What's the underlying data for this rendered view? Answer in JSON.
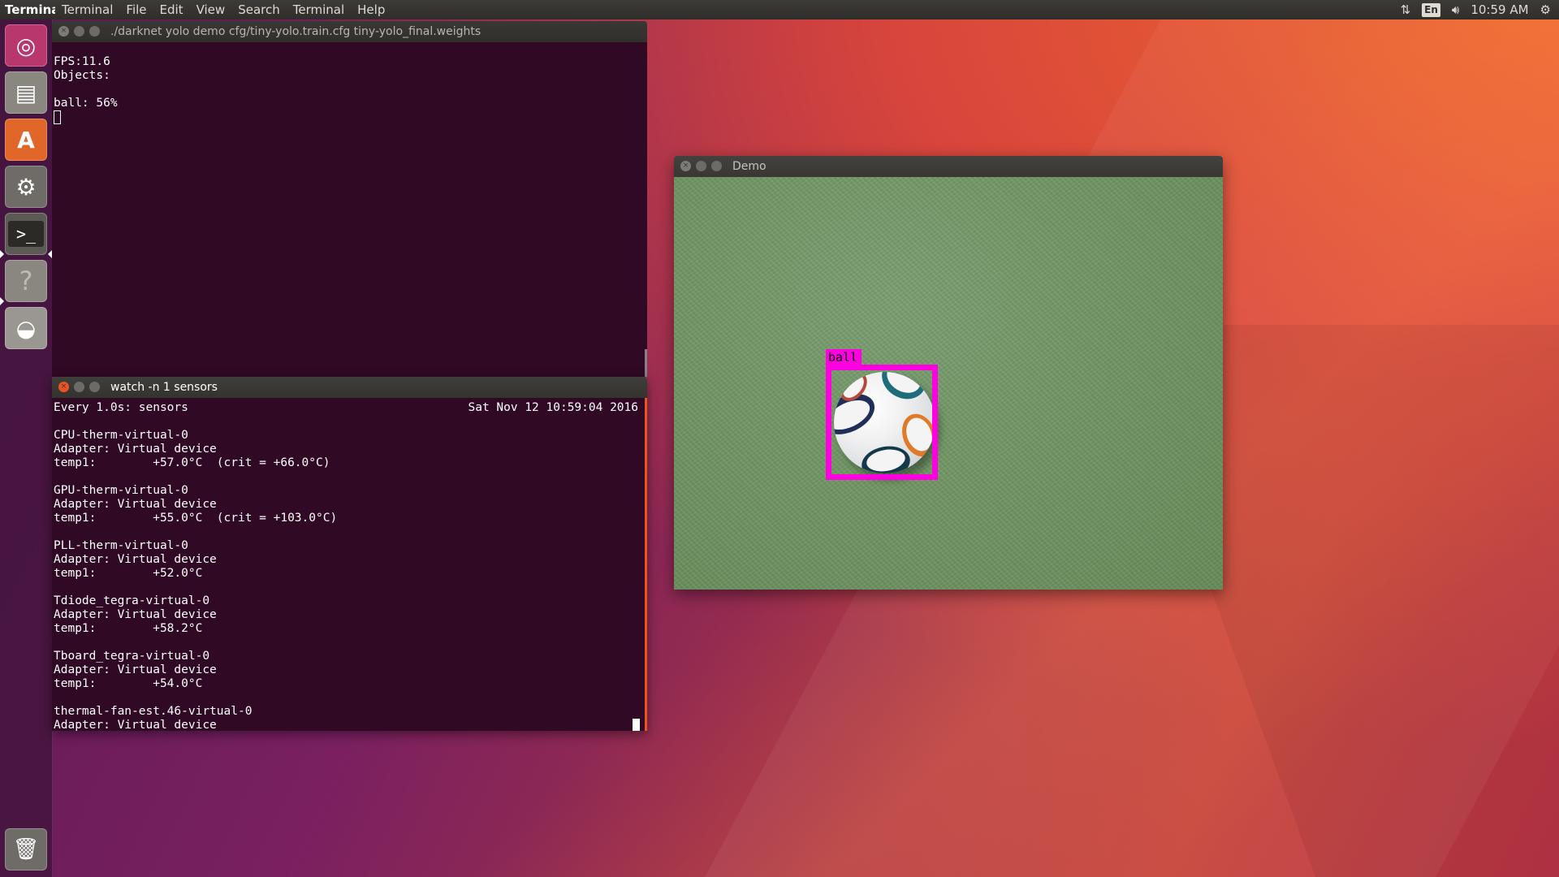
{
  "top_panel": {
    "app_title": "Terminal",
    "menus": [
      "Terminal",
      "File",
      "Edit",
      "View",
      "Search",
      "Terminal",
      "Help"
    ],
    "keyboard_layout": "En",
    "clock": "10:59 AM"
  },
  "launcher": {
    "items": [
      {
        "name": "dash-home",
        "icon": "ubuntu-logo-icon",
        "glyph": "◎",
        "color": "#c0407a"
      },
      {
        "name": "files",
        "icon": "file-cabinet-icon",
        "glyph": "▤",
        "color": "#8a8680"
      },
      {
        "name": "software-center",
        "icon": "shopping-bag-icon",
        "glyph": "A",
        "color": "#e8702a"
      },
      {
        "name": "system-settings",
        "icon": "gear-wrench-icon",
        "glyph": "⚙",
        "color": "#7a7772"
      },
      {
        "name": "terminal",
        "icon": "terminal-icon",
        "glyph": "›_",
        "color": "#3a3935"
      },
      {
        "name": "help",
        "icon": "question-mark-icon",
        "glyph": "?",
        "color": "#8a8680"
      },
      {
        "name": "disk-drive",
        "icon": "hard-drive-icon",
        "glyph": "◒",
        "color": "#9a9792"
      },
      {
        "name": "trash",
        "icon": "trash-icon",
        "glyph": "🗑",
        "color": "#7a7772"
      }
    ]
  },
  "term1": {
    "title": "./darknet yolo demo cfg/tiny-yolo.train.cfg tiny-yolo_final.weights",
    "lines": [
      "FPS:11.6",
      "Objects:",
      "",
      "ball: 56%"
    ]
  },
  "term2": {
    "title": "watch -n 1 sensors",
    "header_left": "Every 1.0s: sensors",
    "header_right": "Sat Nov 12 10:59:04 2016",
    "lines": [
      "",
      "CPU-therm-virtual-0",
      "Adapter: Virtual device",
      "temp1:        +57.0°C  (crit = +66.0°C)",
      "",
      "GPU-therm-virtual-0",
      "Adapter: Virtual device",
      "temp1:        +55.0°C  (crit = +103.0°C)",
      "",
      "PLL-therm-virtual-0",
      "Adapter: Virtual device",
      "temp1:        +52.0°C",
      "",
      "Tdiode_tegra-virtual-0",
      "Adapter: Virtual device",
      "temp1:        +58.2°C",
      "",
      "Tboard_tegra-virtual-0",
      "Adapter: Virtual device",
      "temp1:        +54.0°C",
      "",
      "thermal-fan-est.46-virtual-0",
      "Adapter: Virtual device"
    ]
  },
  "demo": {
    "title": "Demo",
    "detection_label": "ball",
    "detection_color": "#ff00e0"
  }
}
